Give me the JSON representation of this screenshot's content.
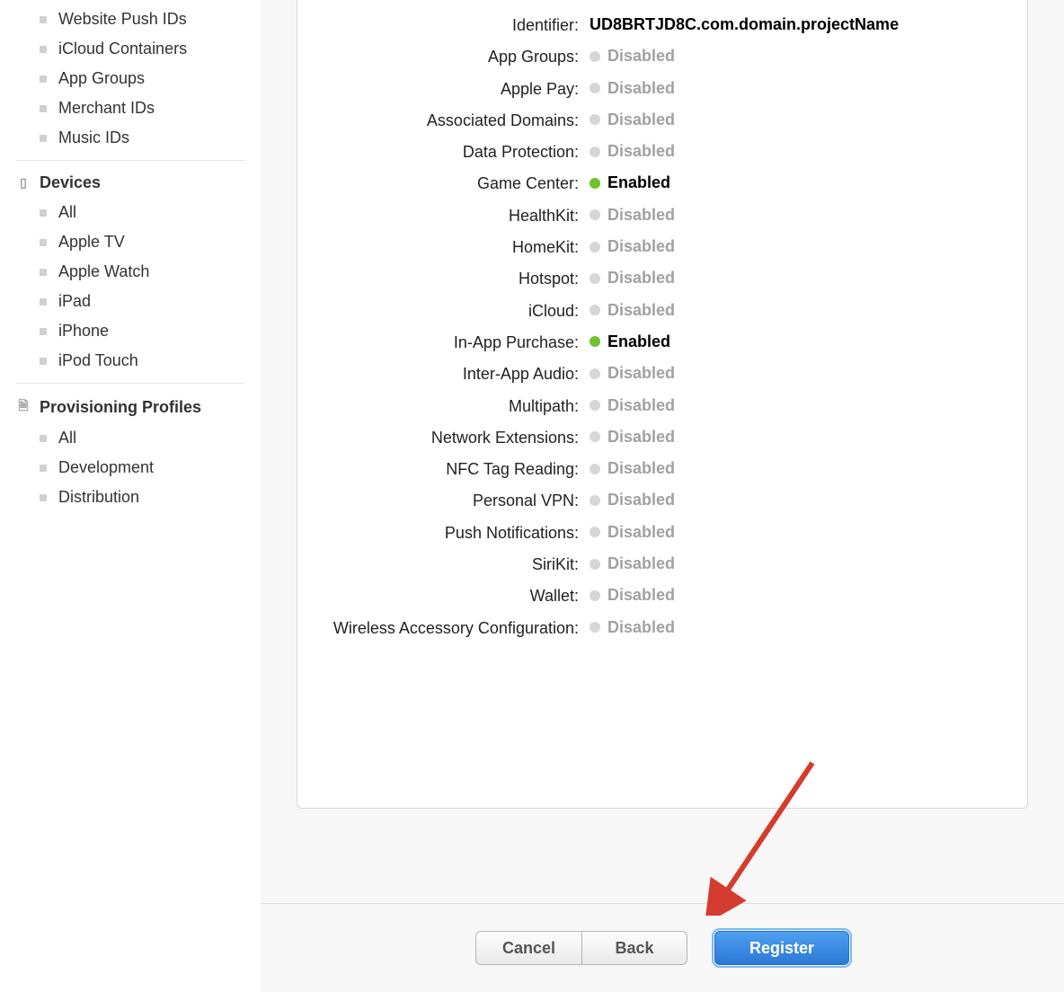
{
  "sidebar": {
    "top_items": [
      "Website Push IDs",
      "iCloud Containers",
      "App Groups",
      "Merchant IDs",
      "Music IDs"
    ],
    "devices_heading": "Devices",
    "devices_items": [
      "All",
      "Apple TV",
      "Apple Watch",
      "iPad",
      "iPhone",
      "iPod Touch"
    ],
    "profiles_heading": "Provisioning Profiles",
    "profiles_items": [
      "All",
      "Development",
      "Distribution"
    ]
  },
  "identifier_label": "Identifier:",
  "identifier_value": "UD8BRTJD8C.com.domain.projectName",
  "capabilities": [
    {
      "label": "App Groups:",
      "status": "Disabled"
    },
    {
      "label": "Apple Pay:",
      "status": "Disabled"
    },
    {
      "label": "Associated Domains:",
      "status": "Disabled"
    },
    {
      "label": "Data Protection:",
      "status": "Disabled"
    },
    {
      "label": "Game Center:",
      "status": "Enabled"
    },
    {
      "label": "HealthKit:",
      "status": "Disabled"
    },
    {
      "label": "HomeKit:",
      "status": "Disabled"
    },
    {
      "label": "Hotspot:",
      "status": "Disabled"
    },
    {
      "label": "iCloud:",
      "status": "Disabled"
    },
    {
      "label": "In-App Purchase:",
      "status": "Enabled"
    },
    {
      "label": "Inter-App Audio:",
      "status": "Disabled"
    },
    {
      "label": "Multipath:",
      "status": "Disabled"
    },
    {
      "label": "Network Extensions:",
      "status": "Disabled"
    },
    {
      "label": "NFC Tag Reading:",
      "status": "Disabled"
    },
    {
      "label": "Personal VPN:",
      "status": "Disabled"
    },
    {
      "label": "Push Notifications:",
      "status": "Disabled"
    },
    {
      "label": "SiriKit:",
      "status": "Disabled"
    },
    {
      "label": "Wallet:",
      "status": "Disabled"
    },
    {
      "label": "Wireless Accessory Configuration:",
      "status": "Disabled"
    }
  ],
  "buttons": {
    "cancel": "Cancel",
    "back": "Back",
    "register": "Register"
  }
}
